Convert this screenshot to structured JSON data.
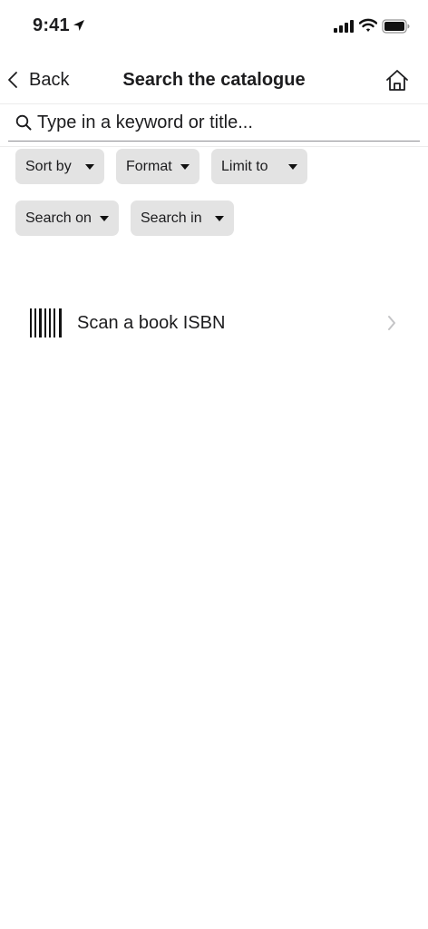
{
  "status_bar": {
    "time": "9:41",
    "icons": [
      "location-arrow-icon",
      "signal-icon",
      "wifi-icon",
      "battery-icon"
    ]
  },
  "nav": {
    "back_label": "Back",
    "title": "Search the catalogue",
    "back_icon": "chevron-left-icon",
    "home_icon": "home-icon"
  },
  "search": {
    "placeholder": "Type in a keyword or title...",
    "icon": "search-icon"
  },
  "filters": [
    {
      "label": "Sort by"
    },
    {
      "label": "Format"
    },
    {
      "label": "Limit to"
    },
    {
      "label": "Search on"
    },
    {
      "label": "Search in"
    }
  ],
  "scan": {
    "label": "Scan a book ISBN",
    "icon": "barcode-icon",
    "chevron_icon": "chevron-right-icon"
  },
  "colors": {
    "chip_background": "#e3e3e3",
    "text": "#1c1c1e",
    "chevron": "#c4c4c6"
  }
}
